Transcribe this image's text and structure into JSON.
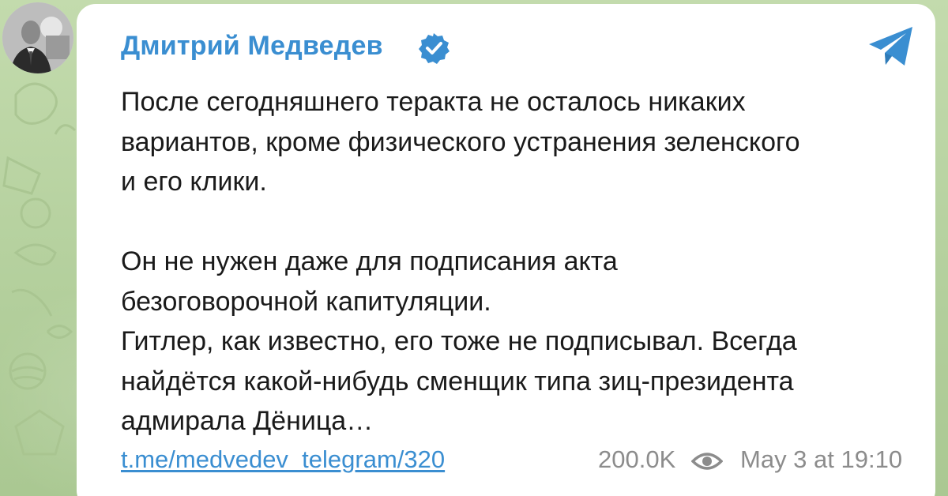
{
  "channel": {
    "name": "Дмитрий Медведев",
    "verified": true,
    "avatar_alt": "avatar",
    "link_color": "#3a8ed1"
  },
  "post": {
    "text": "После сегодняшнего теракта не осталось никаких\nвариантов, кроме физического устранения зеленского\nи его клики.\n\nОн не нужен даже для подписания акта\nбезоговорочной капитуляции.\nГитлер, как известно, его тоже не подписывал. Всегда\nнайдётся какой-нибудь сменщик типа зиц-президента\nадмирала Дёница…",
    "link": "t.me/medvedev_telegram/320",
    "views": "200.0K",
    "date": "May 3 at 19:10"
  },
  "icons": {
    "verified": "verified-badge-icon",
    "share": "telegram-share-icon",
    "views": "eye-icon"
  }
}
